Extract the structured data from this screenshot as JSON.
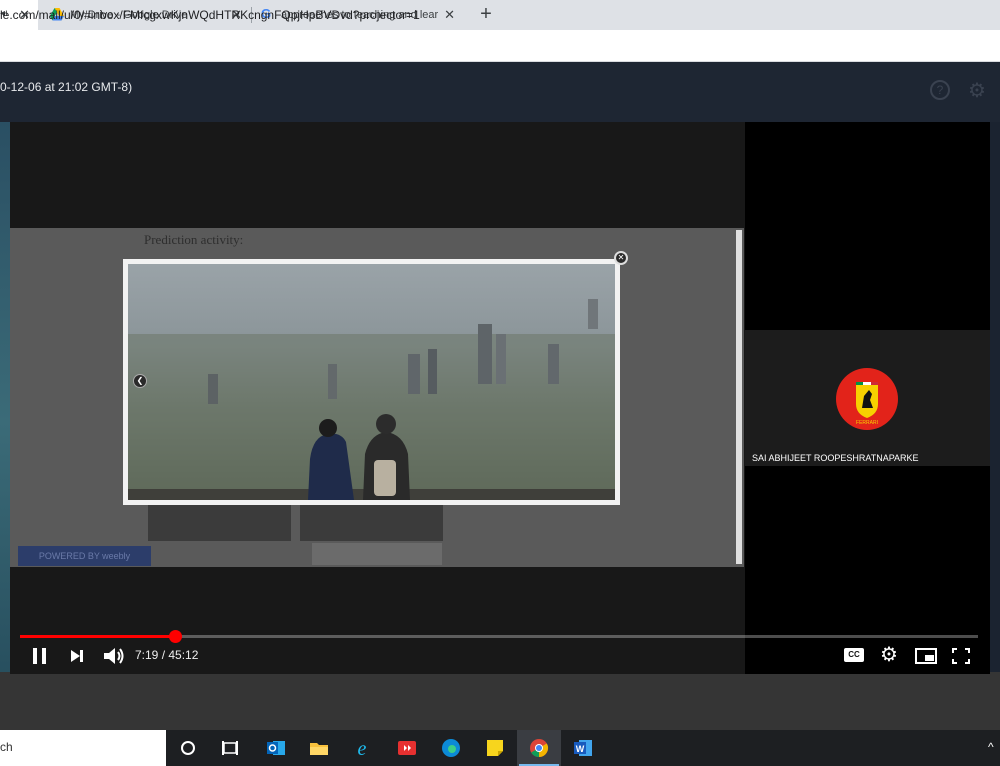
{
  "browser": {
    "tabs": [
      {
        "title": "",
        "close": "✕"
      },
      {
        "title": "My Drive - Google Drive",
        "close": "✕"
      },
      {
        "title": "approaches to teaching and lear",
        "close": "✕"
      }
    ],
    "new_tab": "+",
    "url": "le.com/mail/u/0/#inbox/FMfcgxwKjnWQdHTRKcngnFQpjHpBVDvd?projector=1"
  },
  "page": {
    "date_text": "0-12-06 at 21:02 GMT-8)"
  },
  "slide": {
    "heading": "Prediction activity:",
    "weebly_label": "POWERED BY weebly"
  },
  "participant": {
    "name": "SAI ABHIJEET ROOPESHRATNAPARKE",
    "logo_text": "FERRARI"
  },
  "player": {
    "time": "7:19 / 45:12",
    "progress": 0.162,
    "captions_label": "CC"
  },
  "taskbar": {
    "search_text": "ch"
  }
}
